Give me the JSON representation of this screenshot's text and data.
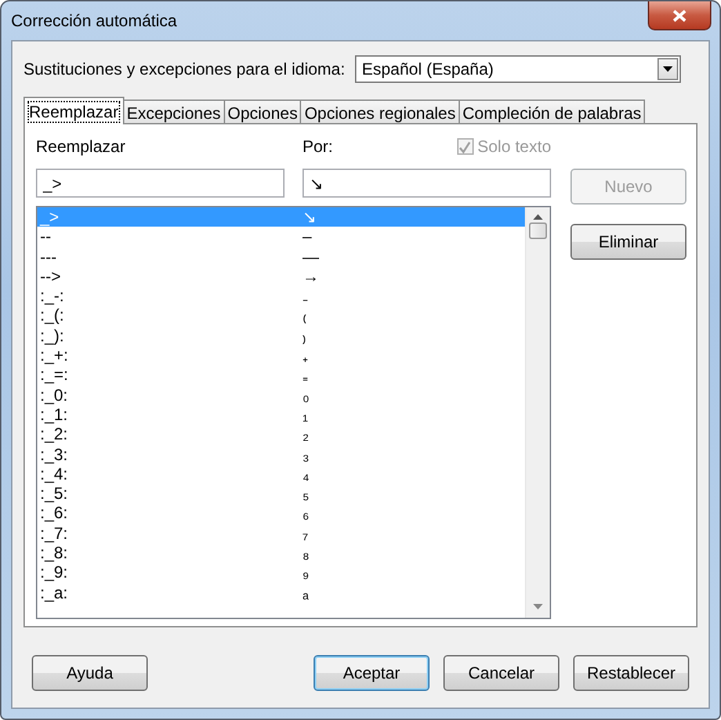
{
  "window": {
    "title": "Corrección automática"
  },
  "language": {
    "label": "Sustituciones y excepciones para el idioma:",
    "value": "Español (España)"
  },
  "tabs": [
    {
      "label": "Reemplazar",
      "selected": true
    },
    {
      "label": "Excepciones",
      "selected": false
    },
    {
      "label": "Opciones",
      "selected": false
    },
    {
      "label": "Opciones regionales",
      "selected": false
    },
    {
      "label": "Compleción de palabras",
      "selected": false
    }
  ],
  "replace": {
    "label": "Reemplazar",
    "value": "_>"
  },
  "with": {
    "label": "Por:",
    "value": "↘"
  },
  "text_only": {
    "label": "Solo texto",
    "checked": true,
    "disabled": true
  },
  "side_buttons": [
    {
      "label": "Nuevo",
      "disabled": true
    },
    {
      "label": "Eliminar",
      "disabled": false
    }
  ],
  "rows": [
    {
      "replace": "_>",
      "with": "↘",
      "selected": true
    },
    {
      "replace": "--",
      "with": "–",
      "selected": false
    },
    {
      "replace": "---",
      "with": "—",
      "selected": false
    },
    {
      "replace": "-->",
      "with": "→",
      "selected": false
    },
    {
      "replace": ":_-:",
      "with": "₋",
      "selected": false
    },
    {
      "replace": ":_(:",
      "with": "₍",
      "selected": false
    },
    {
      "replace": ":_):",
      "with": "₎",
      "selected": false
    },
    {
      "replace": ":_+:",
      "with": "₊",
      "selected": false
    },
    {
      "replace": ":_=:",
      "with": "₌",
      "selected": false
    },
    {
      "replace": ":_0:",
      "with": "₀",
      "selected": false
    },
    {
      "replace": ":_1:",
      "with": "₁",
      "selected": false
    },
    {
      "replace": ":_2:",
      "with": "₂",
      "selected": false
    },
    {
      "replace": ":_3:",
      "with": "₃",
      "selected": false
    },
    {
      "replace": ":_4:",
      "with": "₄",
      "selected": false
    },
    {
      "replace": ":_5:",
      "with": "₅",
      "selected": false
    },
    {
      "replace": ":_6:",
      "with": "₆",
      "selected": false
    },
    {
      "replace": ":_7:",
      "with": "₇",
      "selected": false
    },
    {
      "replace": ":_8:",
      "with": "₈",
      "selected": false
    },
    {
      "replace": ":_9:",
      "with": "₉",
      "selected": false
    },
    {
      "replace": ":_a:",
      "with": "ₐ",
      "selected": false
    }
  ],
  "buttons": [
    {
      "label": "Ayuda",
      "kind": "secondary"
    },
    {
      "label": "Aceptar",
      "kind": "default"
    },
    {
      "label": "Cancelar",
      "kind": "normal"
    },
    {
      "label": "Restablecer",
      "kind": "normal"
    }
  ]
}
